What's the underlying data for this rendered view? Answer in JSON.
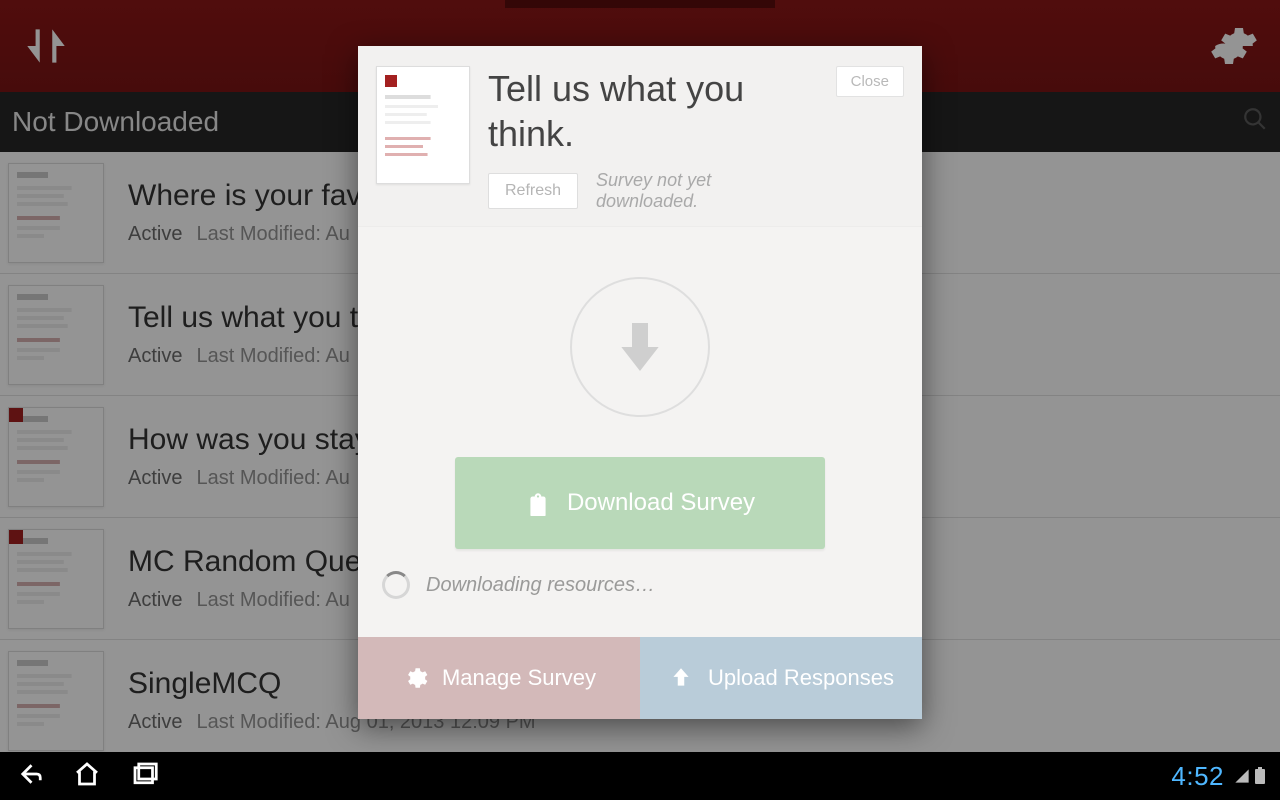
{
  "section_header": "Not Downloaded",
  "list": [
    {
      "title": "Where is your favo",
      "status": "Active",
      "modified": "Last Modified: Au",
      "corner": false
    },
    {
      "title": "Tell us what you t",
      "status": "Active",
      "modified": "Last Modified: Au",
      "corner": false
    },
    {
      "title": "How was you stay",
      "status": "Active",
      "modified": "Last Modified: Au",
      "corner": true
    },
    {
      "title": "MC Random Que",
      "status": "Active",
      "modified": "Last Modified: Au",
      "corner": true
    },
    {
      "title": "SingleMCQ",
      "status": "Active",
      "modified": "Last Modified: Aug 01, 2013 12:09 PM",
      "corner": false
    }
  ],
  "modal": {
    "title": "Tell us what you think.",
    "close": "Close",
    "refresh": "Refresh",
    "substatus": "Survey not yet downloaded.",
    "download": "Download Survey",
    "progress": "Downloading resources…",
    "manage": "Manage Survey",
    "upload": "Upload Responses"
  },
  "system": {
    "clock": "4:52"
  }
}
